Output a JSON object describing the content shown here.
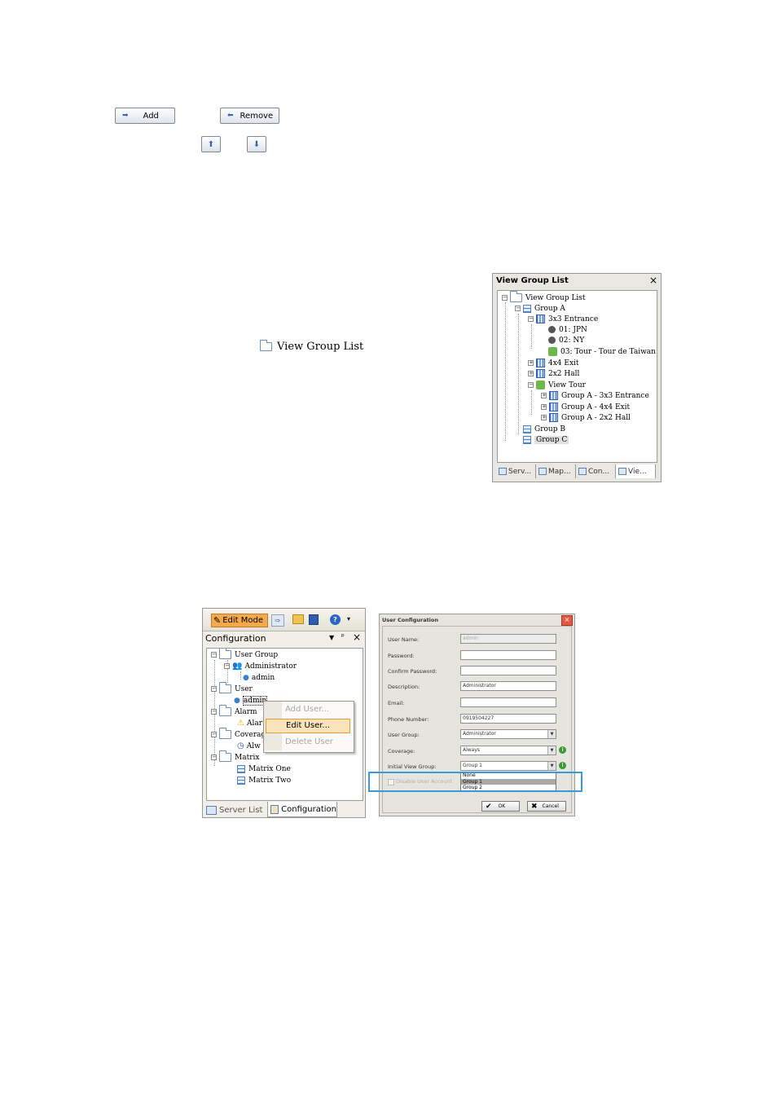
{
  "buttons": {
    "add_label": "Add",
    "remove_label": "Remove"
  },
  "inline": {
    "view_group_list_label": "View Group List"
  },
  "view_group_panel": {
    "title": "View Group List",
    "close": "×",
    "tree": [
      {
        "label": "View Group List"
      },
      {
        "label": "Group A"
      },
      {
        "label": "3x3 Entrance"
      },
      {
        "label": "01: JPN"
      },
      {
        "label": "02: NY"
      },
      {
        "label": "03: Tour - Tour de Taiwan"
      },
      {
        "label": "4x4 Exit"
      },
      {
        "label": "2x2 Hall"
      },
      {
        "label": "View Tour"
      },
      {
        "label": "Group A - 3x3 Entrance"
      },
      {
        "label": "Group A - 4x4 Exit"
      },
      {
        "label": "Group A - 2x2 Hall"
      },
      {
        "label": "Group B"
      },
      {
        "label": "Group C"
      }
    ],
    "tabs": [
      "Serv...",
      "Map...",
      "Con...",
      "Vie..."
    ]
  },
  "config_panel": {
    "edit_mode": "Edit Mode",
    "title": "Configuration",
    "tree": [
      {
        "label": "User Group"
      },
      {
        "label": "Administrator"
      },
      {
        "label": "admin"
      },
      {
        "label": "User"
      },
      {
        "label": "admin"
      },
      {
        "label": "Alarm"
      },
      {
        "label": "Alar"
      },
      {
        "label": "Coverag"
      },
      {
        "label": "Alw"
      },
      {
        "label": "Matrix"
      },
      {
        "label": "Matrix One"
      },
      {
        "label": "Matrix Two"
      }
    ],
    "context_menu": [
      "Add User...",
      "Edit User...",
      "Delete User"
    ],
    "tabs": [
      "Server List",
      "Configuration"
    ]
  },
  "user_config": {
    "title": "User Configuration",
    "fields": {
      "user_name_label": "User Name:",
      "user_name_value": "admin",
      "password_label": "Password:",
      "confirm_label": "Confirm Password:",
      "description_label": "Description:",
      "description_value": "Administrator",
      "email_label": "Email:",
      "phone_label": "Phone Number:",
      "phone_value": "0919504227",
      "user_group_label": "User Group:",
      "user_group_value": "Administrator",
      "coverage_label": "Coverage:",
      "coverage_value": "Always",
      "initial_view_label": "Initial View Group:",
      "initial_view_value": "Group 1"
    },
    "dropdown_options": [
      "None",
      "Group 1",
      "Group 2"
    ],
    "disable_label": "Disable User Account",
    "ok_label": "OK",
    "cancel_label": "Cancel",
    "highlight_color": "#3a9ad9"
  }
}
